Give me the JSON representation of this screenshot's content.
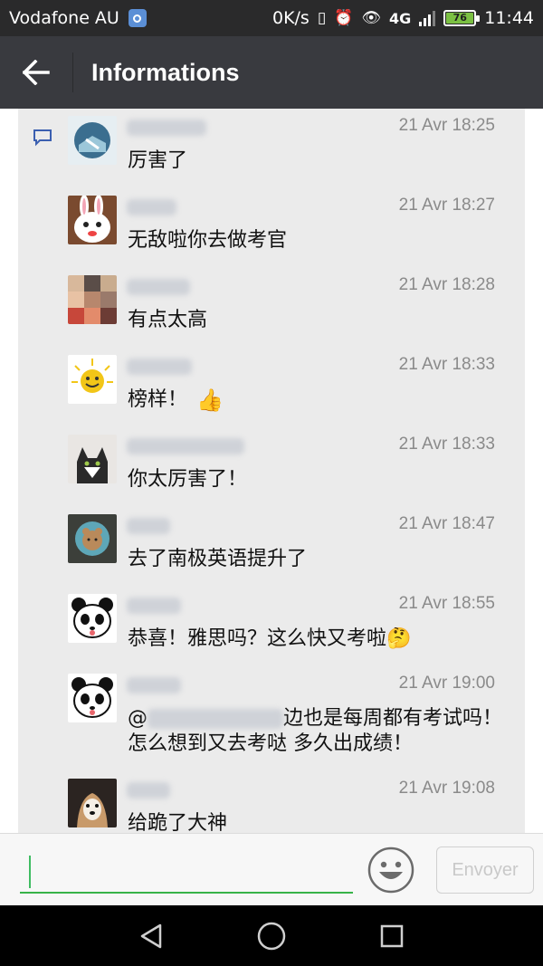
{
  "status_bar": {
    "carrier": "Vodafone AU",
    "speed": "0K/s",
    "network_primary": "4G",
    "network_secondary": "4G",
    "battery": "76",
    "time": "11:44"
  },
  "header": {
    "title": "Informations"
  },
  "comments": [
    {
      "time": "21 Avr 18:25",
      "text": "厉害了",
      "name_width": 88,
      "avatar": "landscape"
    },
    {
      "time": "21 Avr 18:27",
      "text": "无敌啦你去做考官",
      "name_width": 55,
      "avatar": "rabbit"
    },
    {
      "time": "21 Avr 18:28",
      "text": "有点太高",
      "name_width": 70,
      "avatar": "mosaic"
    },
    {
      "time": "21 Avr 18:33",
      "text": "榜样！",
      "emoji": "👍",
      "name_width": 72,
      "avatar": "sun"
    },
    {
      "time": "21 Avr 18:33",
      "text": "你太厉害了！",
      "name_width": 130,
      "avatar": "cat"
    },
    {
      "time": "21 Avr 18:47",
      "text": "去了南极英语提升了",
      "name_width": 48,
      "avatar": "bear"
    },
    {
      "time": "21 Avr 18:55",
      "text": "恭喜！雅思吗？这么快又考啦🤔",
      "name_width": 60,
      "avatar": "panda"
    },
    {
      "time": "21 Avr 19:00",
      "text_prefix": "@",
      "text_suffix": "边也是每周都有考试吗！怎么想到又去考哒 多久出成绩！",
      "name_width": 60,
      "avatar": "panda"
    },
    {
      "time": "21 Avr 19:08",
      "text": "给跪了大神",
      "name_width": 48,
      "avatar": "dog"
    }
  ],
  "input": {
    "placeholder": "",
    "send_label": "Envoyer"
  },
  "colors": {
    "header": "#393a3f",
    "status_bar": "#2a2a2b",
    "accent_green": "#38b349",
    "panel": "#ebebeb"
  }
}
